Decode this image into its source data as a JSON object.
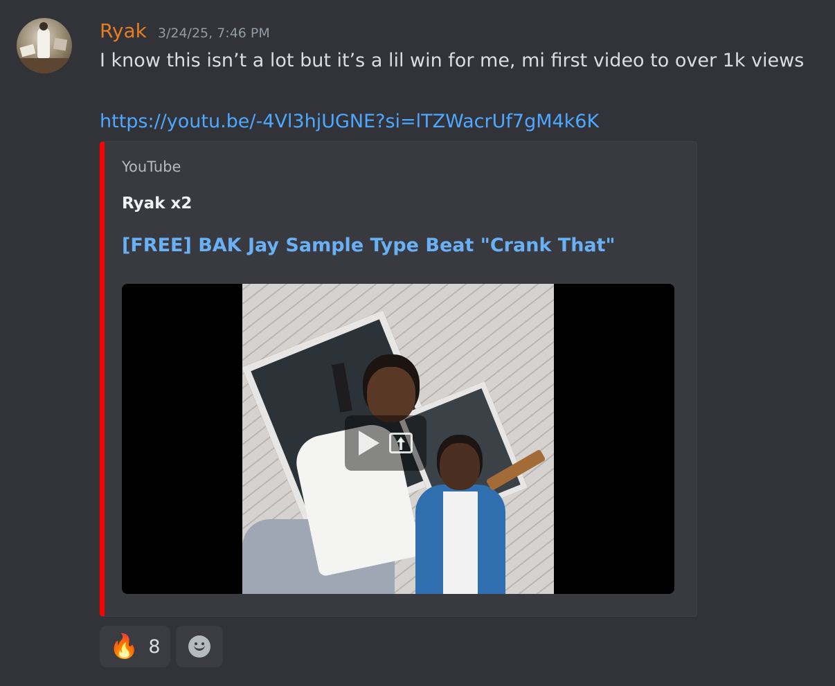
{
  "message": {
    "author": "Ryak",
    "author_color": "#e67e22",
    "timestamp": "3/24/25, 7:46 PM",
    "text": "I know this isn’t a lot but it’s a lil win for me, mi first video to over 1k views",
    "link": "https://youtu.be/-4Vl3hjUGNE?si=lTZWacrUf7gM4k6K"
  },
  "embed": {
    "accent_color": "#ff0000",
    "provider": "YouTube",
    "author": "Ryak x2",
    "title": "[FREE] BAK Jay Sample Type Beat \"Crank That\"",
    "controls": [
      "play-icon",
      "popout-icon"
    ]
  },
  "reactions": [
    {
      "emoji": "🔥",
      "icon": "fire-icon",
      "count": "8"
    }
  ],
  "add_reaction": {
    "icon": "smile-icon"
  }
}
